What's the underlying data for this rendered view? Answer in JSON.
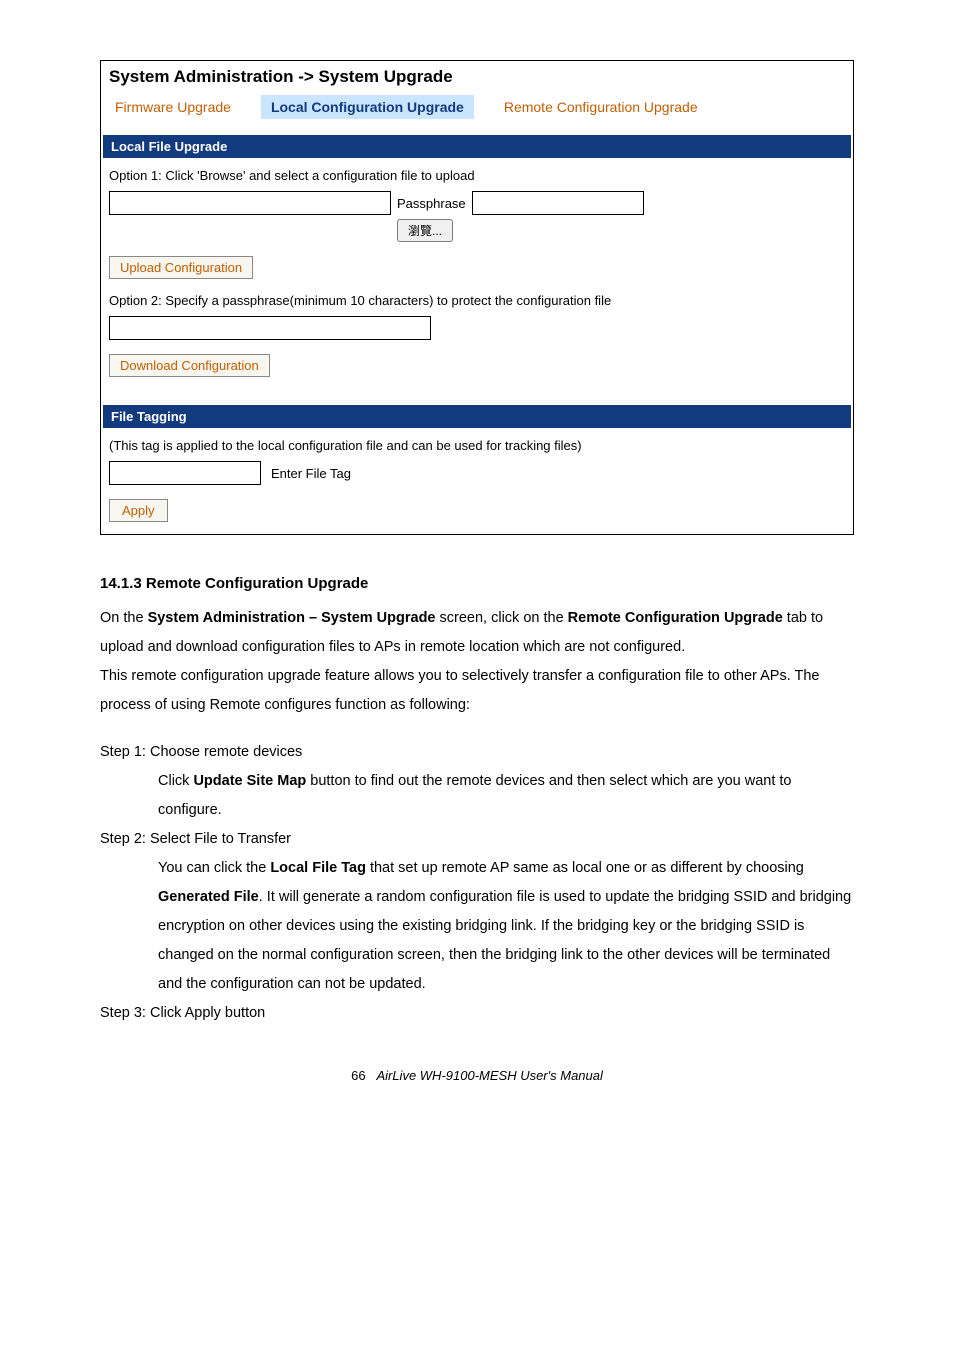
{
  "panel": {
    "title": "System Administration -> System Upgrade",
    "tabs": {
      "firmware": "Firmware Upgrade",
      "local": "Local Configuration Upgrade",
      "remote": "Remote Configuration Upgrade"
    },
    "section1": {
      "header": "Local File Upgrade",
      "option1": "Option 1: Click 'Browse' and select a configuration file to upload",
      "passphrase_label": "Passphrase",
      "browse_label": "瀏覽...",
      "upload_btn": "Upload Configuration",
      "option2": "Option 2: Specify a passphrase(minimum 10 characters) to protect the configuration file",
      "download_btn": "Download Configuration"
    },
    "section2": {
      "header": "File Tagging",
      "desc": "(This tag is applied to the local configuration file and can be used for tracking files)",
      "enter_tag": "Enter File Tag",
      "apply": "Apply"
    }
  },
  "doc": {
    "h3": "14.1.3 Remote Configuration Upgrade",
    "p1_a": "On the ",
    "p1_b": "System Administration – System Upgrade",
    "p1_c": " screen, click on the ",
    "p1_d": "Remote Configuration Upgrade",
    "p1_e": " tab to upload and download configuration files to APs in remote location which are not configured.",
    "p2": "This remote configuration upgrade feature allows you to selectively transfer a configuration file to other APs. The process of using Remote configures function as following:",
    "step1": "Step 1: Choose remote devices",
    "step1_b_a": "Click ",
    "step1_b_b": "Update Site Map",
    "step1_b_c": " button to find out the remote devices and then select which are you want to configure.",
    "step2": "Step 2: Select File to Transfer",
    "step2_b_a": "You can click the ",
    "step2_b_b": "Local File Tag",
    "step2_b_c": " that set up remote AP same as local one or as different by choosing ",
    "step2_b_d": "Generated File",
    "step2_b_e": ". It will generate a random configuration file is used to update the bridging SSID and bridging encryption on other devices using the existing bridging link. If the bridging key or the bridging SSID is changed on the normal configuration screen, then the bridging link to the other devices will be terminated and the configuration can not be updated.",
    "step3": "Step 3: Click Apply button",
    "footer_page": "66",
    "footer_title": "AirLive  WH-9100-MESH  User's  Manual"
  }
}
